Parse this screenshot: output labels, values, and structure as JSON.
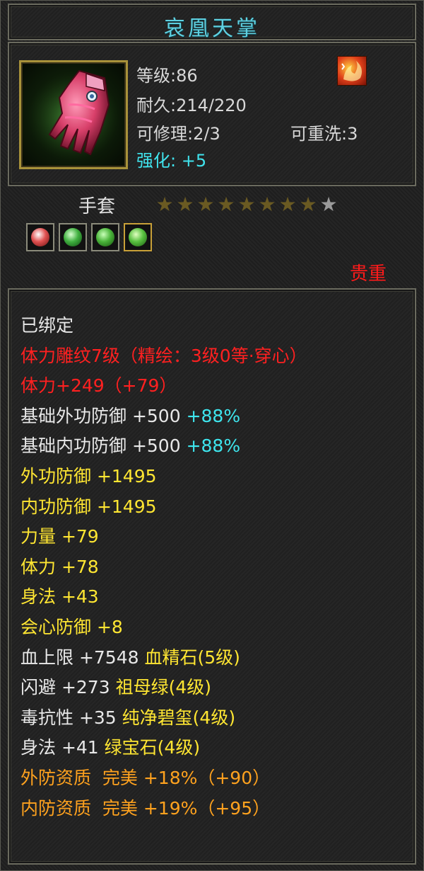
{
  "item": {
    "name": "哀凰天掌",
    "level": "等级:86",
    "durability": "耐久:214/220",
    "repairable": "可修理:2/3",
    "rewash": "可重洗:3",
    "enhance_label": "强化:",
    "enhance_value": "+5",
    "icon": "red-glove-icon",
    "badge_icon": "phoenix-flame-badge-icon",
    "type": "手套",
    "stars_filled": 8,
    "stars_total": 9,
    "gems": [
      "red-gem-icon",
      "green-gem-icon",
      "green-gem-icon",
      "green-gem-icon"
    ],
    "precious": "贵重"
  },
  "attributes": {
    "bound": "已绑定",
    "carving": "体力雕纹7级（精绘：3级0等·穿心）",
    "stamina_main": "体力+249（+79）",
    "base_ext_def": {
      "label": "基础外功防御 +500 ",
      "bonus": "+88%"
    },
    "base_int_def": {
      "label": "基础内功防御 +500 ",
      "bonus": "+88%"
    },
    "ext_def": "外功防御 +1495",
    "int_def": "内功防御 +1495",
    "strength": "力量 +79",
    "stamina": "体力 +78",
    "agility": "身法 +43",
    "crit_def": "会心防御 +8",
    "hp": {
      "label": "血上限 +7548 ",
      "gem": "血精石(5级)"
    },
    "dodge": {
      "label": "闪避 +273 ",
      "gem": "祖母绿(4级)"
    },
    "poison": {
      "label": "毒抗性 +35 ",
      "gem": "纯净碧玺(4级)"
    },
    "agility_gem": {
      "label": "身法 +41 ",
      "gem": "绿宝石(4级)"
    },
    "ext_quality": "外防资质  完美 +18%（+90）",
    "int_quality": "内防资质  完美 +19%（+95）"
  },
  "colors": {
    "title": "#5fd0e0",
    "red": "#ff2020",
    "yellow": "#ffe632",
    "cyan": "#3ee6ee",
    "orange": "#ffa21e"
  }
}
